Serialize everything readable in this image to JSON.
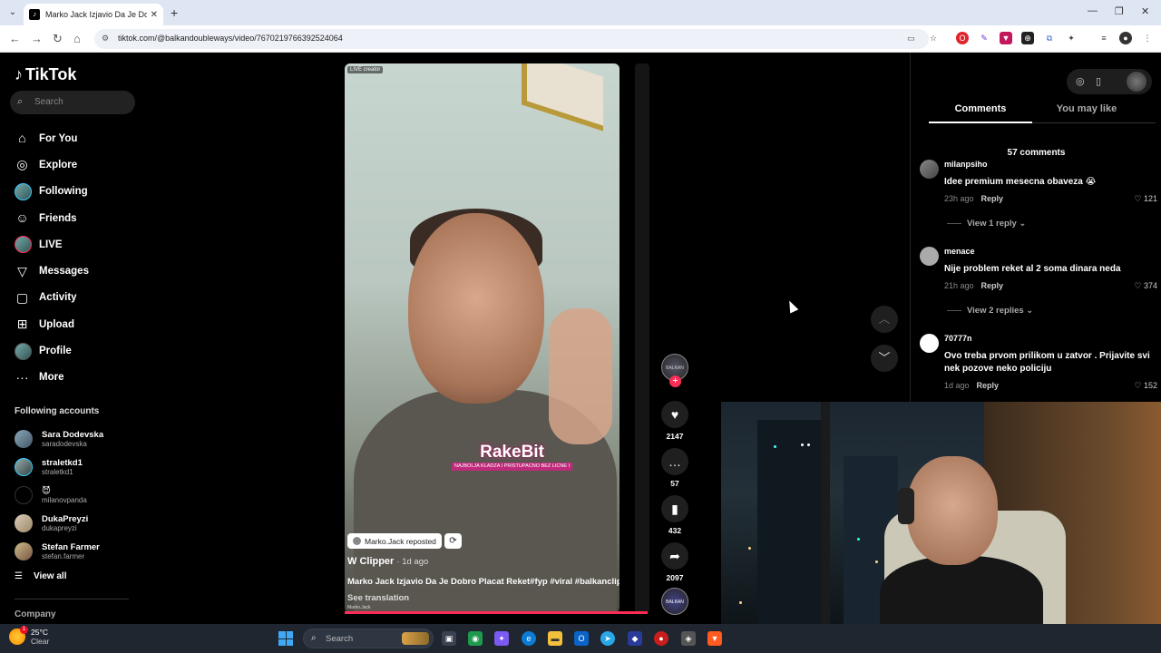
{
  "browser": {
    "tab_title": "Marko Jack Izjavio Da Je Dobro",
    "url": "tiktok.com/@balkandoubleways/video/7670219766392524064"
  },
  "tiktok": {
    "brand": "TikTok",
    "search_placeholder": "Search",
    "menu": [
      {
        "label": "For You",
        "icon": "home-icon"
      },
      {
        "label": "Explore",
        "icon": "compass-icon"
      },
      {
        "label": "Following",
        "icon": "avatar"
      },
      {
        "label": "Friends",
        "icon": "friends-icon"
      },
      {
        "label": "LIVE",
        "icon": "avatar"
      },
      {
        "label": "Messages",
        "icon": "send-icon"
      },
      {
        "label": "Activity",
        "icon": "activity-icon"
      },
      {
        "label": "Upload",
        "icon": "plus-square-icon"
      },
      {
        "label": "Profile",
        "icon": "avatar"
      },
      {
        "label": "More",
        "icon": "more-icon"
      }
    ],
    "following_title": "Following accounts",
    "following": [
      {
        "name": "Sara Dodevska",
        "handle": "saradodevska"
      },
      {
        "name": "straletkd1",
        "handle": "straletkd1"
      },
      {
        "name": "😈",
        "handle": "milanovpanda"
      },
      {
        "name": "DukaPreyzi",
        "handle": "dukapreyzi"
      },
      {
        "name": "Stefan Farmer",
        "handle": "stefan.farmer"
      }
    ],
    "view_all": "View all",
    "company": "Company"
  },
  "video": {
    "live_badge": "LIVE creator",
    "brand_name": "RakeBit",
    "brand_tagline": "NAJBOLJA KLADZA I PRISTUPACNO BEZ LICNE I",
    "repost_label": "Marko.Jack reposted",
    "author": "W Clipper",
    "posted": "· 1d ago",
    "description": "Marko Jack Izjavio Da Je Dobro Placat Reket#fyp #viral #balkanclips",
    "see_translation": "See translation",
    "tag": "Marko.Jack",
    "likes": "2147",
    "comments": "57",
    "saves": "432",
    "shares": "2097",
    "creator_avatar_text": "BALKAN"
  },
  "comments_panel": {
    "tab_comments": "Comments",
    "tab_you_may_like": "You may like",
    "count": "57 comments",
    "items": [
      {
        "user": "milanpsiho",
        "text": "Idee premium mesecna obaveza 😭",
        "time": "23h ago",
        "reply": "Reply",
        "likes": "121",
        "more": "View 1 reply ⌄"
      },
      {
        "user": "menace",
        "text": "Nije problem reket al 2 soma dinara neda",
        "time": "21h ago",
        "reply": "Reply",
        "likes": "374",
        "more": "View 2 replies ⌄"
      },
      {
        "user": "70777n",
        "text": "Ovo treba prvom prilikom u zatvor . Prijavite svi nek pozove neko policiju",
        "time": "1d ago",
        "reply": "Reply",
        "likes": "152",
        "more": ""
      }
    ]
  },
  "taskbar": {
    "weather_temp": "25°C",
    "weather_desc": "Clear",
    "weather_badge": "1",
    "search_placeholder": "Search"
  }
}
